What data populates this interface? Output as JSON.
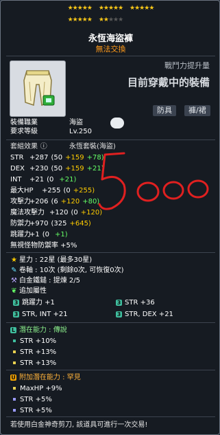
{
  "stars": {
    "row1": [
      "★★★★★",
      "★★★★★",
      "★★★★★"
    ],
    "row2_on": "★★★★★",
    "row2_partial_on": "★★",
    "row2_partial_off": "★★★"
  },
  "item": {
    "name": "永恆海盜褲",
    "untradeable": "無法交換",
    "cp_label": "戰鬥力提升量",
    "cp_big": "目前穿戴中的裝備",
    "category": "防具",
    "subtype": "褲/裙"
  },
  "req": {
    "job_label": "裝備職業",
    "job_value": "海盜",
    "level_label": "要求等級",
    "level_value": "Lv.250"
  },
  "set": {
    "label": "套組效果",
    "value": "永恆套裝(海盜)"
  },
  "stats": [
    {
      "name": "STR",
      "total": "+287",
      "a": "(50",
      "b": "+159",
      "c": "+78)"
    },
    {
      "name": "DEX",
      "total": "+230",
      "a": "(50",
      "b": "+159",
      "c": "+21)"
    },
    {
      "name": "INT",
      "total": "+21",
      "a": "(0",
      "b": "",
      "c": "+21)"
    },
    {
      "name": "最大HP",
      "total": "+255",
      "a": "(0",
      "b": "+255)",
      "c": ""
    },
    {
      "name": "攻擊力",
      "total": "+206",
      "a": "(6",
      "b": "+120",
      "c": "+80)"
    },
    {
      "name": "魔法攻擊力",
      "total": "+120",
      "a": "(0",
      "b": "+120)",
      "c": ""
    },
    {
      "name": "防禦力",
      "total": "+970",
      "a": "(325",
      "b": "+645)",
      "c": ""
    },
    {
      "name": "跳躍力",
      "total": "+1",
      "a": "(0",
      "b": "",
      "c": "+1)"
    }
  ],
  "ignore_def": "無視怪物防禦率   +5%",
  "info": {
    "star": "星力 : 22星 (最多30星)",
    "scroll": "卷軸 : 10次 (剩餘0次, 可恢復0次)",
    "hammer": "白金鐵鎚 : 提煉 2/5",
    "extra": "追加屬性"
  },
  "flames": [
    [
      "跳躍力 +1",
      "STR   +36"
    ],
    [
      "STR, INT   +21",
      "STR, DEX   +21"
    ]
  ],
  "potential": {
    "label": "潛在能力 : 傳說",
    "lines": [
      "STR +10%",
      "STR +13%",
      "STR +13%"
    ]
  },
  "bonus": {
    "label": "附加潛在能力 : 罕見",
    "lines": [
      "MaxHP +9%",
      "STR +5%",
      "STR +5%"
    ]
  },
  "footer": "若使用白金神奇剪刀, 該道具可進行一次交易!",
  "colors": {
    "legendary": "#3fbf9f",
    "rare": "#f0a000",
    "scribble": "#e02020"
  }
}
